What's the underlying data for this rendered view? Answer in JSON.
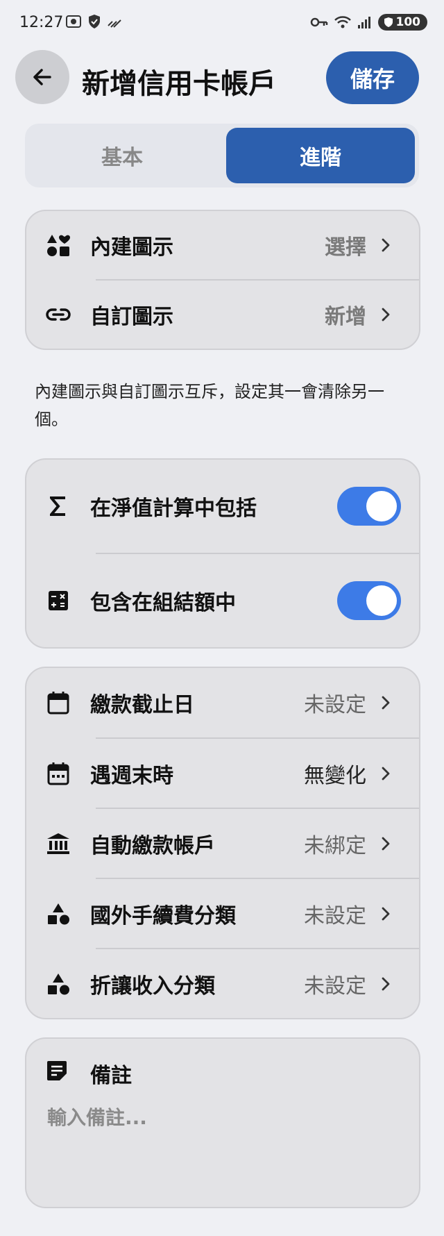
{
  "status_bar": {
    "time": "12:27",
    "battery": "100"
  },
  "header": {
    "title": "新增信用卡帳戶",
    "save_label": "儲存"
  },
  "tabs": [
    {
      "label": "基本"
    },
    {
      "label": "進階",
      "active": true
    }
  ],
  "icon_section": {
    "rows": [
      {
        "icon": "shapes-icon",
        "label": "內建圖示",
        "value": "選擇"
      },
      {
        "icon": "link-icon",
        "label": "自訂圖示",
        "value": "新增"
      }
    ],
    "note": "內建圖示與自訂圖示互斥，設定其一會清除另一個。"
  },
  "toggles_section": {
    "rows": [
      {
        "icon": "sigma-icon",
        "label": "在淨值計算中包括",
        "on": true
      },
      {
        "icon": "calculator-icon",
        "label": "包含在組結額中",
        "on": true
      }
    ]
  },
  "settings_section": {
    "rows": [
      {
        "icon": "calendar-icon",
        "label": "繳款截止日",
        "value": "未設定"
      },
      {
        "icon": "calendar-week-icon",
        "label": "遇週末時",
        "value": "無變化"
      },
      {
        "icon": "bank-icon",
        "label": "自動繳款帳戶",
        "value": "未綁定"
      },
      {
        "icon": "shapes-icon",
        "label": "國外手續費分類",
        "value": "未設定"
      },
      {
        "icon": "shapes-icon",
        "label": "折讓收入分類",
        "value": "未設定"
      }
    ]
  },
  "memo": {
    "label": "備註",
    "placeholder": "輸入備註..."
  },
  "colors": {
    "accent": "#2c5fae",
    "toggle_on": "#3d7be7",
    "background": "#eff0f4",
    "card": "#e3e3e6"
  }
}
